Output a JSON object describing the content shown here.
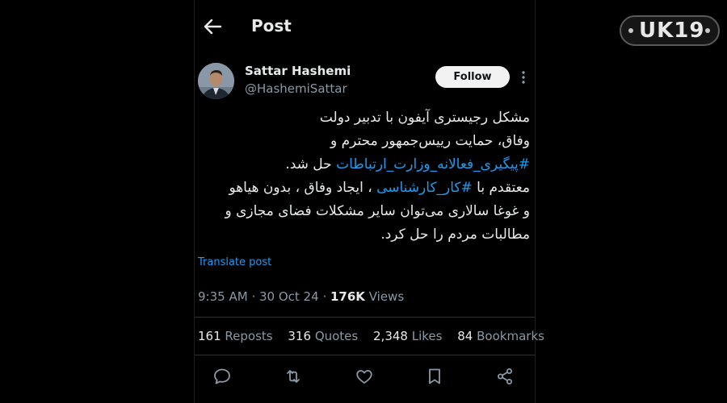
{
  "header": {
    "title": "Post"
  },
  "author": {
    "name": "Sattar Hashemi",
    "handle": "@HashemiSattar"
  },
  "follow_label": "Follow",
  "tweet": {
    "lines": [
      "مشکل رجیستری آیفون با تدبیر دولت",
      "وفاق، حمایت  رییس‌جمهور محترم و",
      {
        "hashtag": "#پیگیری_فعالانه_وزارت_ارتباطات",
        "rest": " حل شد."
      },
      {
        "prefix": "معتقدم با ",
        "hashtag": "#کار_کارشناسی",
        "rest": " ، ایجاد وفاق ، بدون هیاهو"
      },
      "و غوغا سالاری می‌توان سایر مشکلات فضای مجازی و",
      "مطالبات مردم را حل کرد."
    ]
  },
  "translate_label": "Translate post",
  "meta": {
    "time": "9:35 AM",
    "sep": "·",
    "date": "30 Oct 24",
    "views": "176K",
    "views_label": "Views"
  },
  "stats": [
    {
      "count": "161",
      "label": "Reposts"
    },
    {
      "count": "316",
      "label": "Quotes"
    },
    {
      "count": "2,348",
      "label": "Likes"
    },
    {
      "count": "84",
      "label": "Bookmarks"
    }
  ],
  "actions": [
    "reply-icon",
    "repost-icon",
    "like-icon",
    "bookmark-icon",
    "share-icon"
  ],
  "watermark": {
    "text": "UK19"
  },
  "colors": {
    "accent": "#1d9bf0",
    "background": "#000000",
    "text": "#e7e9ea",
    "secondary": "#8b98a5"
  }
}
